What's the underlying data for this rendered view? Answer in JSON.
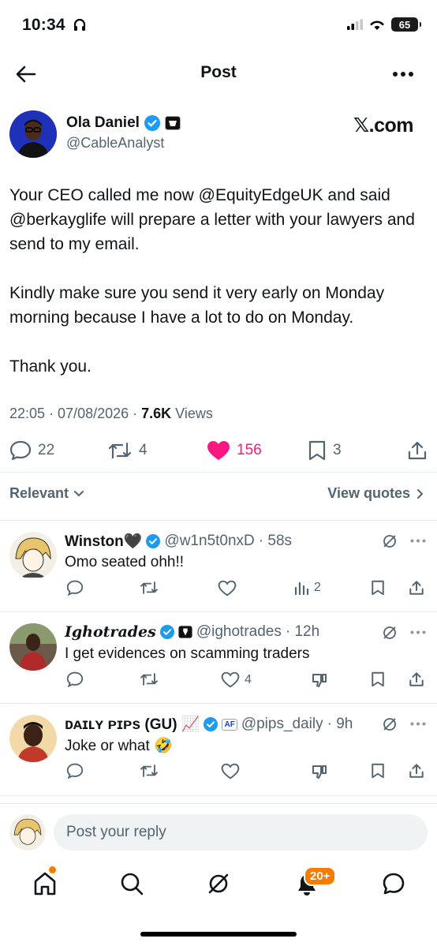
{
  "status_bar": {
    "time": "10:34",
    "battery": "65"
  },
  "header": {
    "title": "Post"
  },
  "post": {
    "author_name": "Ola Daniel",
    "author_handle": "@CableAnalyst",
    "source": "𝕏.com",
    "paragraphs": [
      "Your CEO called me now @EquityEdgeUK and said @berkayglife will prepare a letter with your lawyers and send to my email.",
      "Kindly make sure you send it very early on Monday morning because I have a lot to do on Monday.",
      "Thank you."
    ],
    "timestamp": "22:05 · 07/08/2026 · ",
    "views_count": "7.6K",
    "views_label": " Views",
    "replies": "22",
    "reposts": "4",
    "likes": "156",
    "bookmarks": "3"
  },
  "filter": {
    "left": "Relevant",
    "right": "View quotes"
  },
  "replies": [
    {
      "name": "Winston🖤",
      "handle": "@w1n5t0nxD",
      "time": "· 58s",
      "text": "Omo seated ohh!!",
      "likes": "",
      "views": "2"
    },
    {
      "name": "Ighotrades",
      "handle": "@ighotrades",
      "time": "· 12h",
      "text": "I get evidences on scamming traders",
      "likes": "4",
      "views": ""
    },
    {
      "name": "ᴅᴀɪʟʏ ᴘɪᴘs (GU) 📈",
      "handle": "@pips_daily",
      "time": "· 9h",
      "text": "Joke or what 🤣",
      "likes": "",
      "views": "",
      "affiliate": "AF"
    }
  ],
  "composer": {
    "placeholder": "Post your reply"
  },
  "tab_bar": {
    "notifications_badge": "20+"
  },
  "colors": {
    "blue_check": "#1d9bf0",
    "like_pink": "#f91880",
    "badge_orange": "#f57c00",
    "muted_text": "#536471"
  }
}
